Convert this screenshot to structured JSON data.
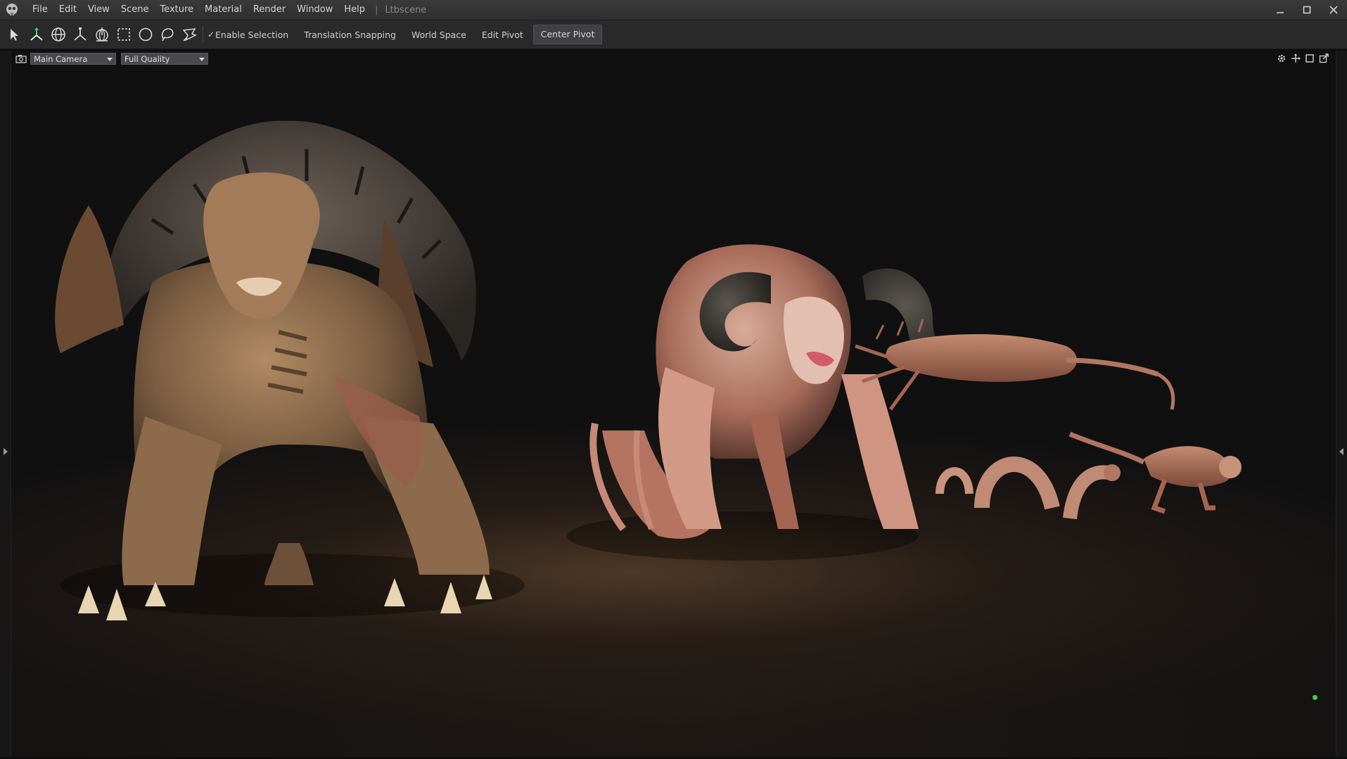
{
  "menubar": {
    "logo_icon": "skull-logo-icon",
    "items": [
      "File",
      "Edit",
      "View",
      "Scene",
      "Texture",
      "Material",
      "Render",
      "Window",
      "Help"
    ],
    "separator": "|",
    "document_title": "Ltbscene",
    "window_controls": [
      "minimize-icon",
      "maximize-icon",
      "close-icon"
    ]
  },
  "toolbar": {
    "tools": [
      "select-arrow-icon",
      "move-gizmo-icon",
      "rotate-gizmo-icon",
      "scale-gizmo-icon",
      "universal-gizmo-icon",
      "rect-select-icon",
      "circle-select-icon",
      "lasso-select-icon",
      "paint-select-icon"
    ],
    "enable_selection": {
      "label": "Enable Selection",
      "checked": true
    },
    "translation_snapping": {
      "label": "Translation Snapping",
      "checked": false
    },
    "world_space": {
      "label": "World Space",
      "checked": false
    },
    "edit_pivot": {
      "label": "Edit Pivot",
      "checked": false
    },
    "center_pivot_label": "Center Pivot"
  },
  "viewport": {
    "camera_icon": "camera-icon",
    "camera_select": "Main Camera",
    "quality_select": "Full Quality",
    "tools": [
      "settings-gear-icon",
      "pan-cross-icon",
      "maximize-view-icon",
      "popout-icon"
    ],
    "status_indicator_color": "#3fd04a"
  },
  "colors": {
    "menubar_bg": "#333334",
    "toolbar_bg": "#2a2a2b",
    "viewport_bg": "#101011",
    "accent_green": "#3fd04a"
  }
}
